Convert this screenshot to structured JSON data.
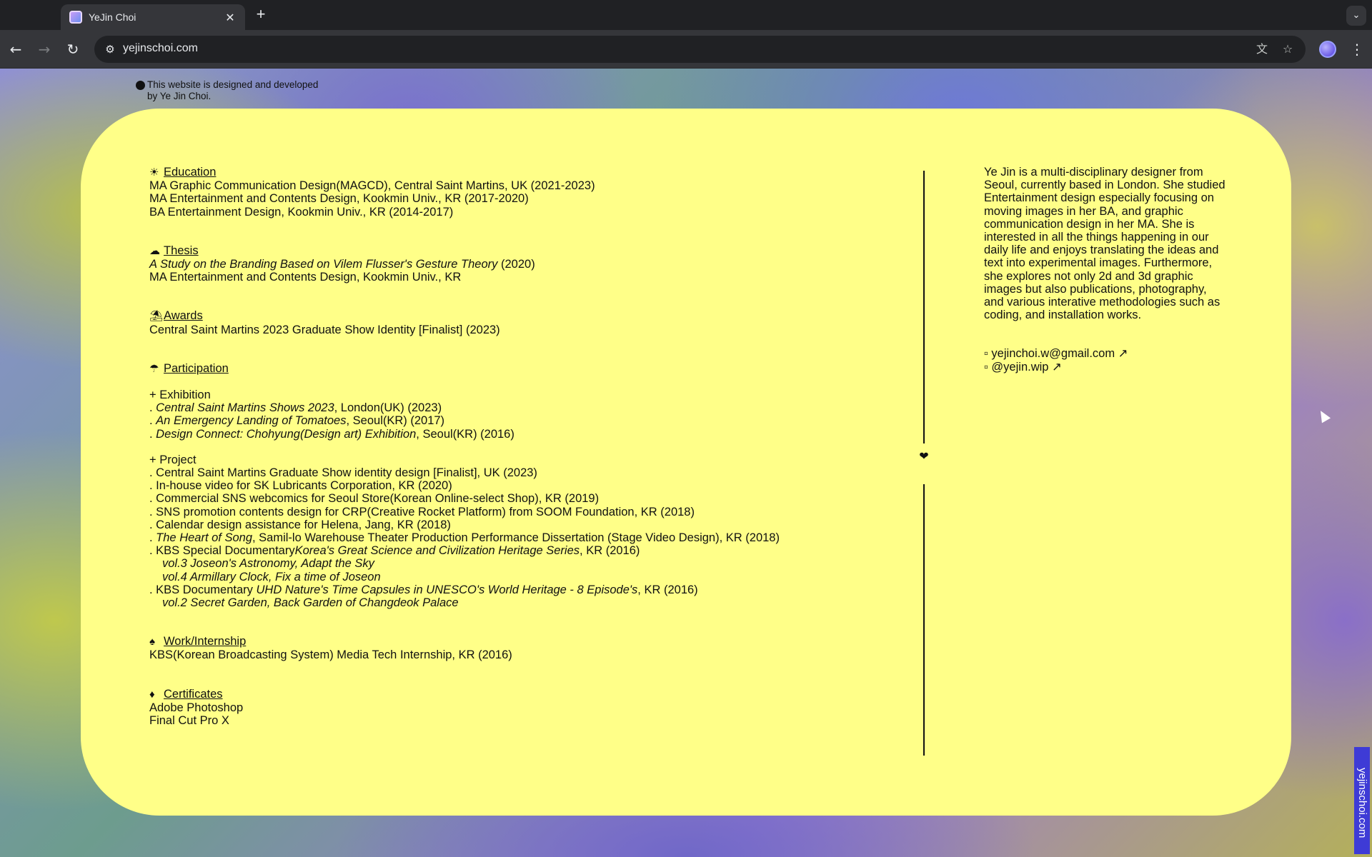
{
  "browser": {
    "tab_title": "YeJin Choi",
    "tab_close": "✕",
    "new_tab": "+",
    "tab_search": "⌄",
    "back": "←",
    "forward": "→",
    "reload": "↻",
    "site_info": "⚙",
    "url": "yejinschoi.com",
    "translate_icon": "文",
    "bookmark_icon": "☆",
    "menu": "⋮"
  },
  "credit": {
    "line1": "This website is designed and developed",
    "line2": "by Ye Jin Choi."
  },
  "sections": {
    "education": {
      "icon": "☀",
      "title": "Education",
      "lines": [
        "MA Graphic Communication Design(MAGCD), Central Saint Martins, UK (2021-2023)",
        "MA Entertainment and Contents Design, Kookmin Univ., KR (2017-2020)",
        "BA Entertainment Design, Kookmin Univ., KR (2014-2017)"
      ]
    },
    "thesis": {
      "icon": "☁",
      "title": "Thesis",
      "italic": "A Study on the Branding Based on Vilem Flusser's Gesture Theory",
      "year": " (2020)",
      "line2": "MA Entertainment and Contents Design, Kookmin Univ., KR"
    },
    "awards": {
      "icon": "⛱",
      "title": "Awards",
      "line": "Central Saint Martins 2023 Graduate Show Identity [Finalist] (2023)"
    },
    "participation": {
      "icon": "☂",
      "title": "Participation",
      "exhibition_head": "+ Exhibition",
      "exhibitions": [
        {
          "prefix": ". ",
          "italic": "Central Saint Martins Shows 2023",
          "rest": ", London(UK) (2023)"
        },
        {
          "prefix": ". ",
          "italic": "An Emergency Landing of Tomatoes",
          "rest": ", Seoul(KR) (2017)"
        },
        {
          "prefix": ". ",
          "italic": "Design Connect: Chohyung(Design art) Exhibition",
          "rest": ", Seoul(KR) (2016)"
        }
      ],
      "project_head": "+ Project",
      "projects": [
        ". Central Saint Martins Graduate Show identity design [Finalist], UK (2023)",
        ". In-house video for SK Lubricants Corporation, KR (2020)",
        ". Commercial SNS webcomics for Seoul Store(Korean Online-select Shop), KR (2019)",
        ". SNS promotion contents design for CRP(Creative Rocket Platform) from SOOM Foundation, KR (2018)",
        ". Calendar design assistance for Helena, Jang, KR (2018)"
      ],
      "project_heart": {
        "prefix": ". ",
        "italic": "The Heart of Song",
        "rest": ", Samil-lo Warehouse Theater Production Performance Dissertation (Stage Video Design), KR (2018)"
      },
      "project_kbs1": {
        "prefix": ". KBS Special Documentary",
        "italic": "Korea's Great Science and Civilization Heritage Series",
        "rest": ", KR (2016)"
      },
      "project_kbs1_sub": [
        "vol.3 Joseon's Astronomy, Adapt the Sky",
        "vol.4 Armillary Clock, Fix a time of Joseon"
      ],
      "project_kbs2": {
        "prefix": ". KBS Documentary ",
        "italic": "UHD Nature's Time Capsules in UNESCO's World Heritage - 8 Episode's",
        "rest": ", KR (2016)"
      },
      "project_kbs2_sub": [
        "vol.2 Secret Garden, Back Garden of Changdeok Palace"
      ]
    },
    "work": {
      "icon": "♠",
      "title": "Work/Internship",
      "line": "KBS(Korean Broadcasting System) Media Tech Internship, KR (2016)"
    },
    "certificates": {
      "icon": "♦",
      "title": "Certificates",
      "lines": [
        "Adobe Photoshop",
        "Final Cut Pro X"
      ]
    }
  },
  "divider_icon": "❤",
  "bio": "Ye Jin is a multi-disciplinary designer from Seoul, currently based in London. She studied Entertainment design especially focusing on moving images in her BA, and graphic communication design in her MA. She is interested in all the things happening in our daily life and enjoys translating the ideas and text into experimental images. Furthermore, she explores not only 2d and 3d graphic images but also publications, photography, and various interative methodologies such as coding, and installation works.",
  "contacts": {
    "email": "▫ yejinchoi.w@gmail.com ↗",
    "instagram": "▫ @yejin.wip ↗"
  },
  "vertical_url": "yejinschoi.com",
  "colors": {
    "card": "#ffff88",
    "vertical_badge": "#3e3bd6"
  }
}
